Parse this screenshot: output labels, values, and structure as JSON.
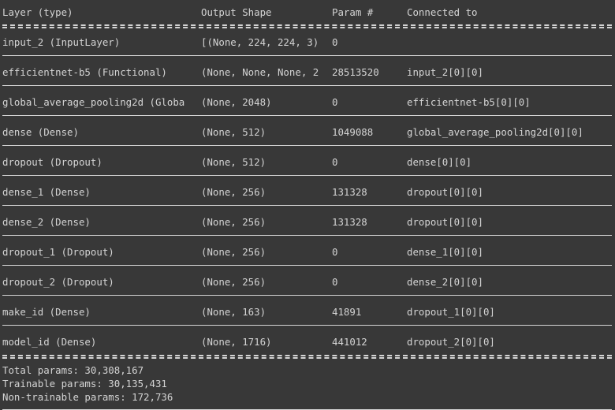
{
  "headers": [
    "Layer (type)",
    "Output Shape",
    "Param #",
    "Connected to"
  ],
  "layers": [
    {
      "name": "input_2 (InputLayer)",
      "shape": "[(None, 224, 224, 3)",
      "params": "0",
      "connected": ""
    },
    {
      "name": "efficientnet-b5 (Functional)",
      "shape": "(None, None, None, 2",
      "params": "28513520",
      "connected": "input_2[0][0]"
    },
    {
      "name": "global_average_pooling2d (Globa",
      "shape": "(None, 2048)",
      "params": "0",
      "connected": "efficientnet-b5[0][0]"
    },
    {
      "name": "dense (Dense)",
      "shape": "(None, 512)",
      "params": "1049088",
      "connected": "global_average_pooling2d[0][0]"
    },
    {
      "name": "dropout (Dropout)",
      "shape": "(None, 512)",
      "params": "0",
      "connected": "dense[0][0]"
    },
    {
      "name": "dense_1 (Dense)",
      "shape": "(None, 256)",
      "params": "131328",
      "connected": "dropout[0][0]"
    },
    {
      "name": "dense_2 (Dense)",
      "shape": "(None, 256)",
      "params": "131328",
      "connected": "dropout[0][0]"
    },
    {
      "name": "dropout_1 (Dropout)",
      "shape": "(None, 256)",
      "params": "0",
      "connected": "dense_1[0][0]"
    },
    {
      "name": "dropout_2 (Dropout)",
      "shape": "(None, 256)",
      "params": "0",
      "connected": "dense_2[0][0]"
    },
    {
      "name": "make_id (Dense)",
      "shape": "(None, 163)",
      "params": "41891",
      "connected": "dropout_1[0][0]"
    },
    {
      "name": "model_id (Dense)",
      "shape": "(None, 1716)",
      "params": "441012",
      "connected": "dropout_2[0][0]"
    }
  ],
  "totals": {
    "total": "Total params: 30,308,167",
    "trainable": "Trainable params: 30,135,431",
    "non_trainable": "Non-trainable params: 172,736"
  },
  "colors": {
    "background": "#383838",
    "text": "#d4d4d4"
  }
}
